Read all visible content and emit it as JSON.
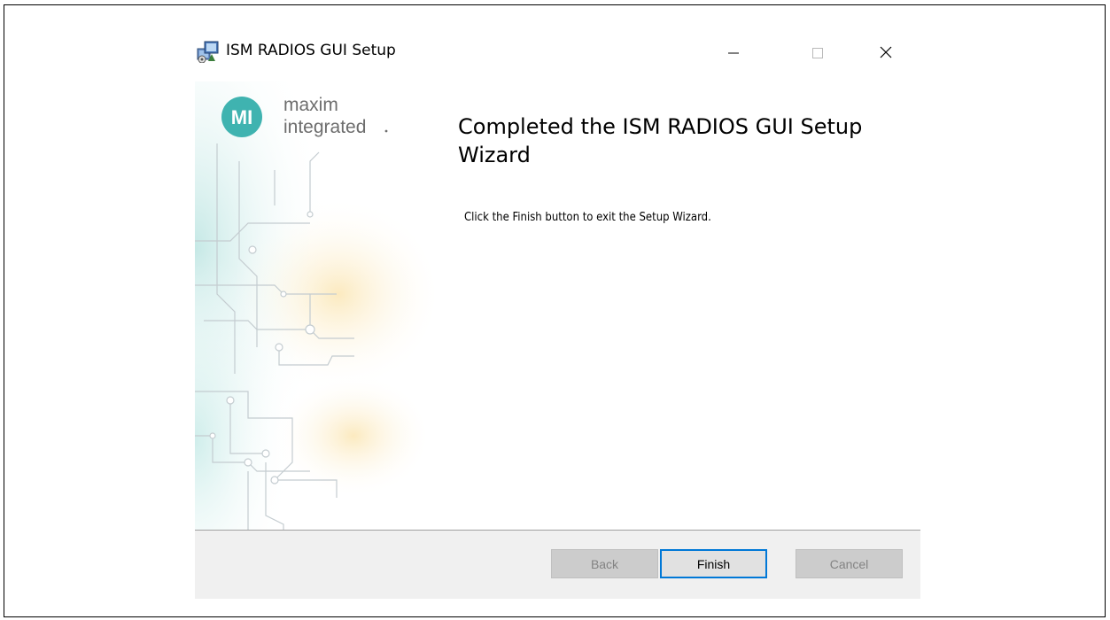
{
  "window": {
    "title": "ISM RADIOS GUI Setup"
  },
  "brand": {
    "line1": "maxim",
    "line2": "integrated",
    "mark": "MI",
    "color": "#3fb3b0"
  },
  "content": {
    "heading": "Completed the ISM RADIOS GUI Setup Wizard",
    "message": "Click the Finish button to exit the Setup Wizard."
  },
  "buttons": {
    "back": "Back",
    "finish": "Finish",
    "cancel": "Cancel"
  },
  "colors": {
    "accent": "#0078d7",
    "teal": "#3fb3b0",
    "footer": "#f0f0f0"
  }
}
